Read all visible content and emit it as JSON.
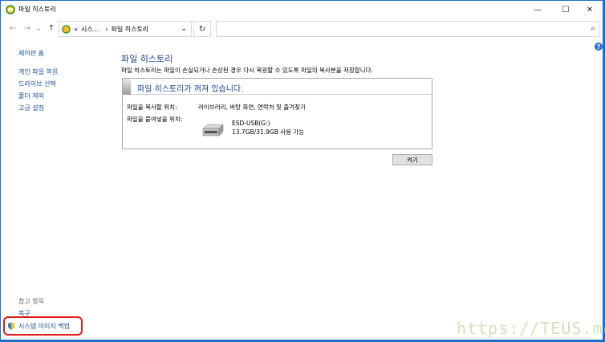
{
  "window": {
    "title": "파일 히스토리",
    "minimize_glyph": "—",
    "maximize_glyph": "☐",
    "close_glyph": "✕"
  },
  "nav": {
    "back_glyph": "←",
    "forward_glyph": "→",
    "dropdown_glyph": "⌄",
    "up_glyph": "↑",
    "refresh_glyph": "↻"
  },
  "address": {
    "prefix": "«",
    "crumbs": [
      "시스...",
      "파일 히스토리"
    ],
    "separator": "›",
    "dropdown_glyph": "⌄"
  },
  "search": {
    "placeholder": "",
    "icon": "search-icon",
    "glyph": "⌕"
  },
  "sidebar": {
    "home": "제어판 홈",
    "links": [
      "개인 파일 복원",
      "드라이브 선택",
      "폴더 제외",
      "고급 설정"
    ],
    "see_also": "참고 항목",
    "bottom_links": [
      "복구",
      "시스템 이미지 백업"
    ]
  },
  "help": {
    "glyph": "?"
  },
  "main": {
    "title": "파일 히스토리",
    "description": "파일 히스토리는 파일이 손실되거나 손상된 경우 다시 복원할 수 있도록 파일의 복사본을 저장합니다.",
    "status_title": "파일 히스토리가 꺼져 있습니다.",
    "copy_from_label": "파일을 복사할 위치:",
    "copy_from_value": "라이브러리, 바탕 화면, 연락처 및 즐겨찾기",
    "copy_to_label": "파일을 붙여넣을 위치:",
    "drive_name": "ESD-USB(G:)",
    "drive_usage": "13.7GB/31.9GB 사용 가능",
    "turn_on_button": "켜기"
  },
  "watermark": "https://TEUS.me",
  "colors": {
    "link": "#1a4fa0",
    "title": "#1a3f8f",
    "highlight": "#e31b1b",
    "border": "#1f6fc2"
  }
}
